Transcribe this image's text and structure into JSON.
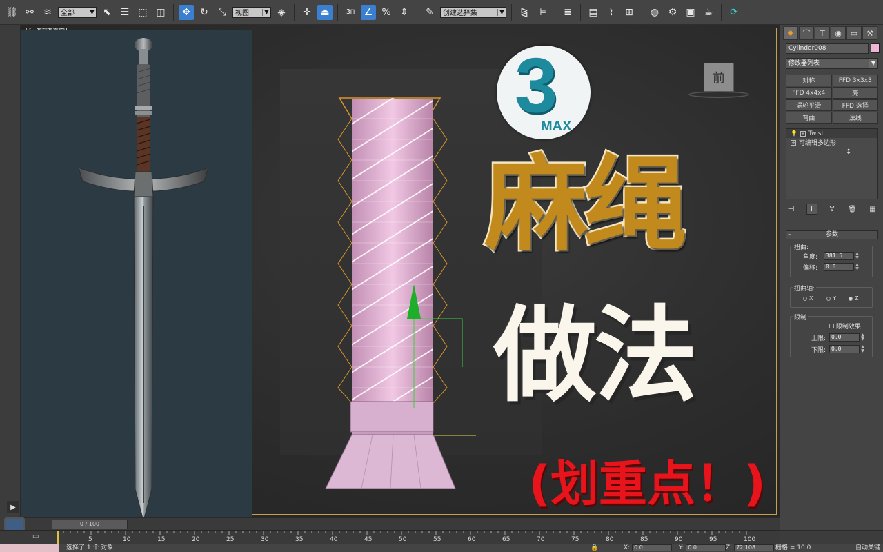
{
  "toolbar": {
    "selection_filter": "全部",
    "ref_coord": "视图",
    "snap_3": "3",
    "named_selection": "创建选择集"
  },
  "viewport": {
    "label": "[+][前][真实]"
  },
  "thumbnail": {
    "logo_number": "3",
    "logo_text": "MAX",
    "viewcube_label": "前",
    "title_line1": "麻绳",
    "title_line2": "做法",
    "title_line3": "(划重点！)"
  },
  "command_panel": {
    "object_name": "Cylinder008",
    "modifier_list": "修改器列表",
    "modifier_buttons": [
      "对称",
      "FFD 3x3x3",
      "FFD 4x4x4",
      "壳",
      "涡轮平滑",
      "FFD 选择",
      "弯曲",
      "法线"
    ],
    "stack": [
      "Twist",
      "可编辑多边形"
    ],
    "rollout_title": "参数",
    "twist_group": "扭曲:",
    "angle_label": "角度:",
    "angle_value": "381.5",
    "bias_label": "偏移:",
    "bias_value": "0.0",
    "axis_group": "扭曲轴:",
    "axis_x": "X",
    "axis_y": "Y",
    "axis_z": "Z",
    "limit_group": "限制",
    "limit_effect": "限制效果",
    "upper_label": "上限:",
    "upper_value": "0.0",
    "lower_label": "下限:",
    "lower_value": "0.0"
  },
  "timeline": {
    "slider_text": "0 / 100",
    "ticks": [
      "5",
      "10",
      "15",
      "20",
      "25",
      "30",
      "35",
      "40",
      "45",
      "50",
      "55",
      "60",
      "65",
      "70",
      "75",
      "80",
      "85",
      "90",
      "95",
      "100"
    ]
  },
  "status": {
    "message": "选择了 1 个 对象",
    "x_label": "X:",
    "x_value": "0.0",
    "y_label": "Y:",
    "y_value": "0.0",
    "z_label": "Z:",
    "z_value": "72.108",
    "grid": "栅格 = 10.0",
    "autokey": "自动关键"
  },
  "colors": {
    "accent": "#3b7fd1",
    "title_gold": "#c28a1c",
    "title_red": "#e8141c",
    "rope_pink": "#e8b8d8"
  }
}
